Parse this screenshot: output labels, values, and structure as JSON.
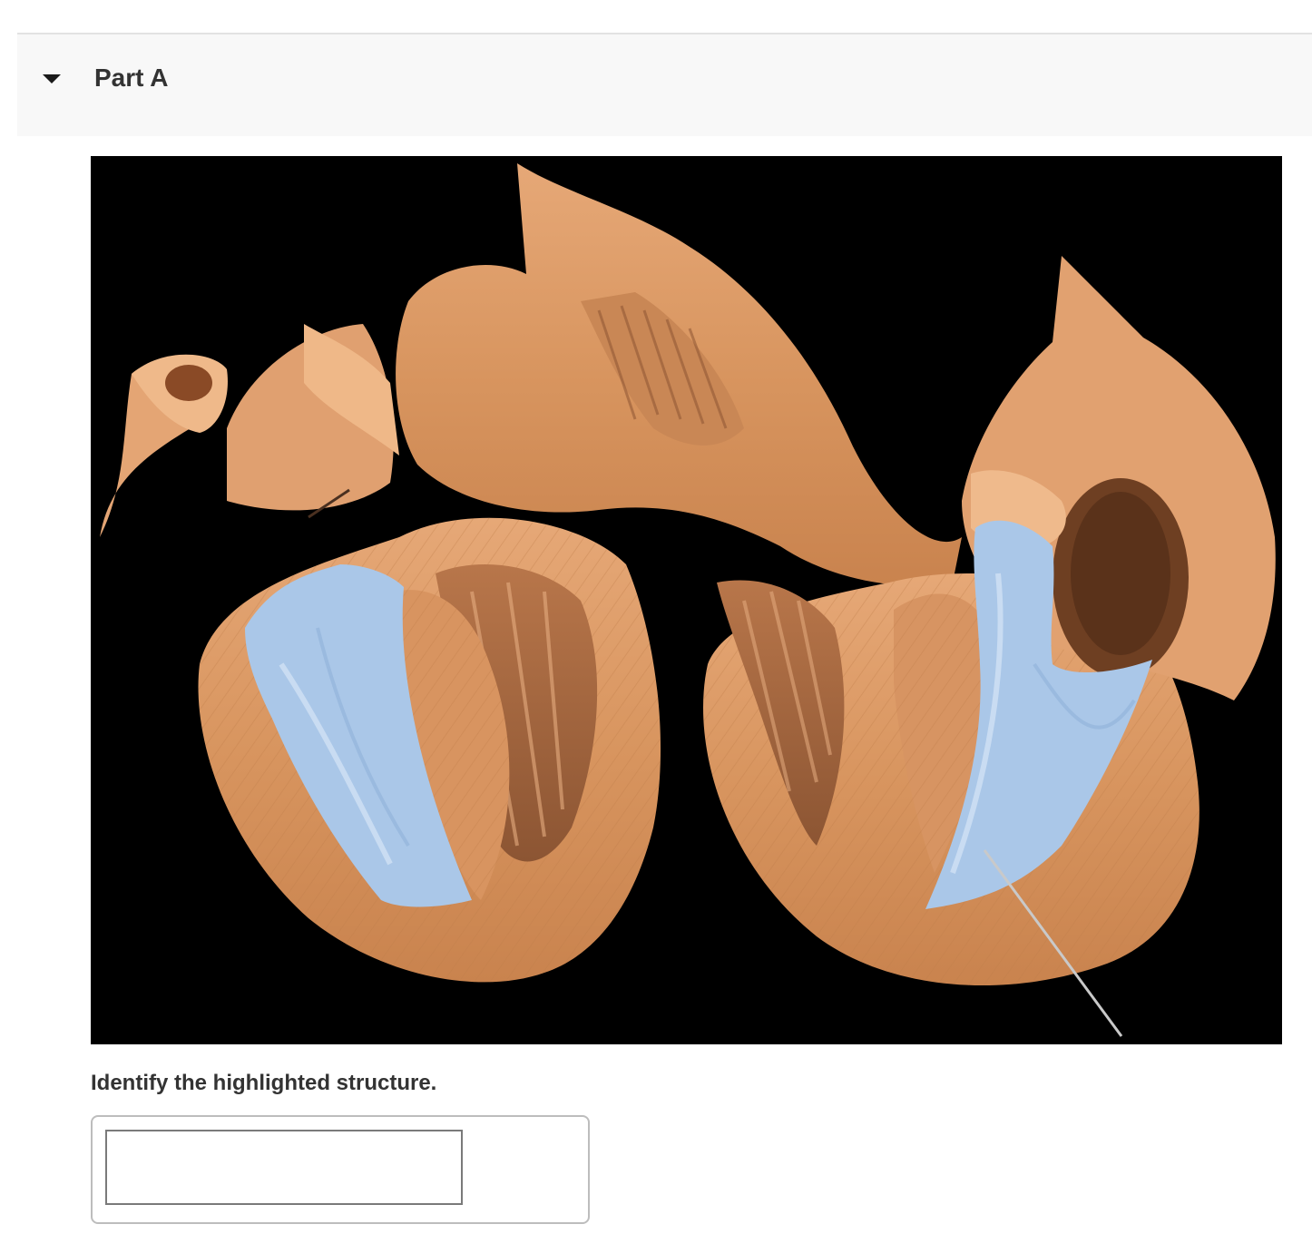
{
  "part": {
    "title": "Part A",
    "toggle_icon": "caret-down-icon"
  },
  "figure": {
    "subject": "heart-dissection-photo",
    "highlight_color": "#a9c6e8",
    "tissue_color": "#d8955f",
    "background_color": "#000000"
  },
  "question": {
    "prompt": "Identify the highlighted structure."
  },
  "answer": {
    "value": "",
    "placeholder": ""
  }
}
